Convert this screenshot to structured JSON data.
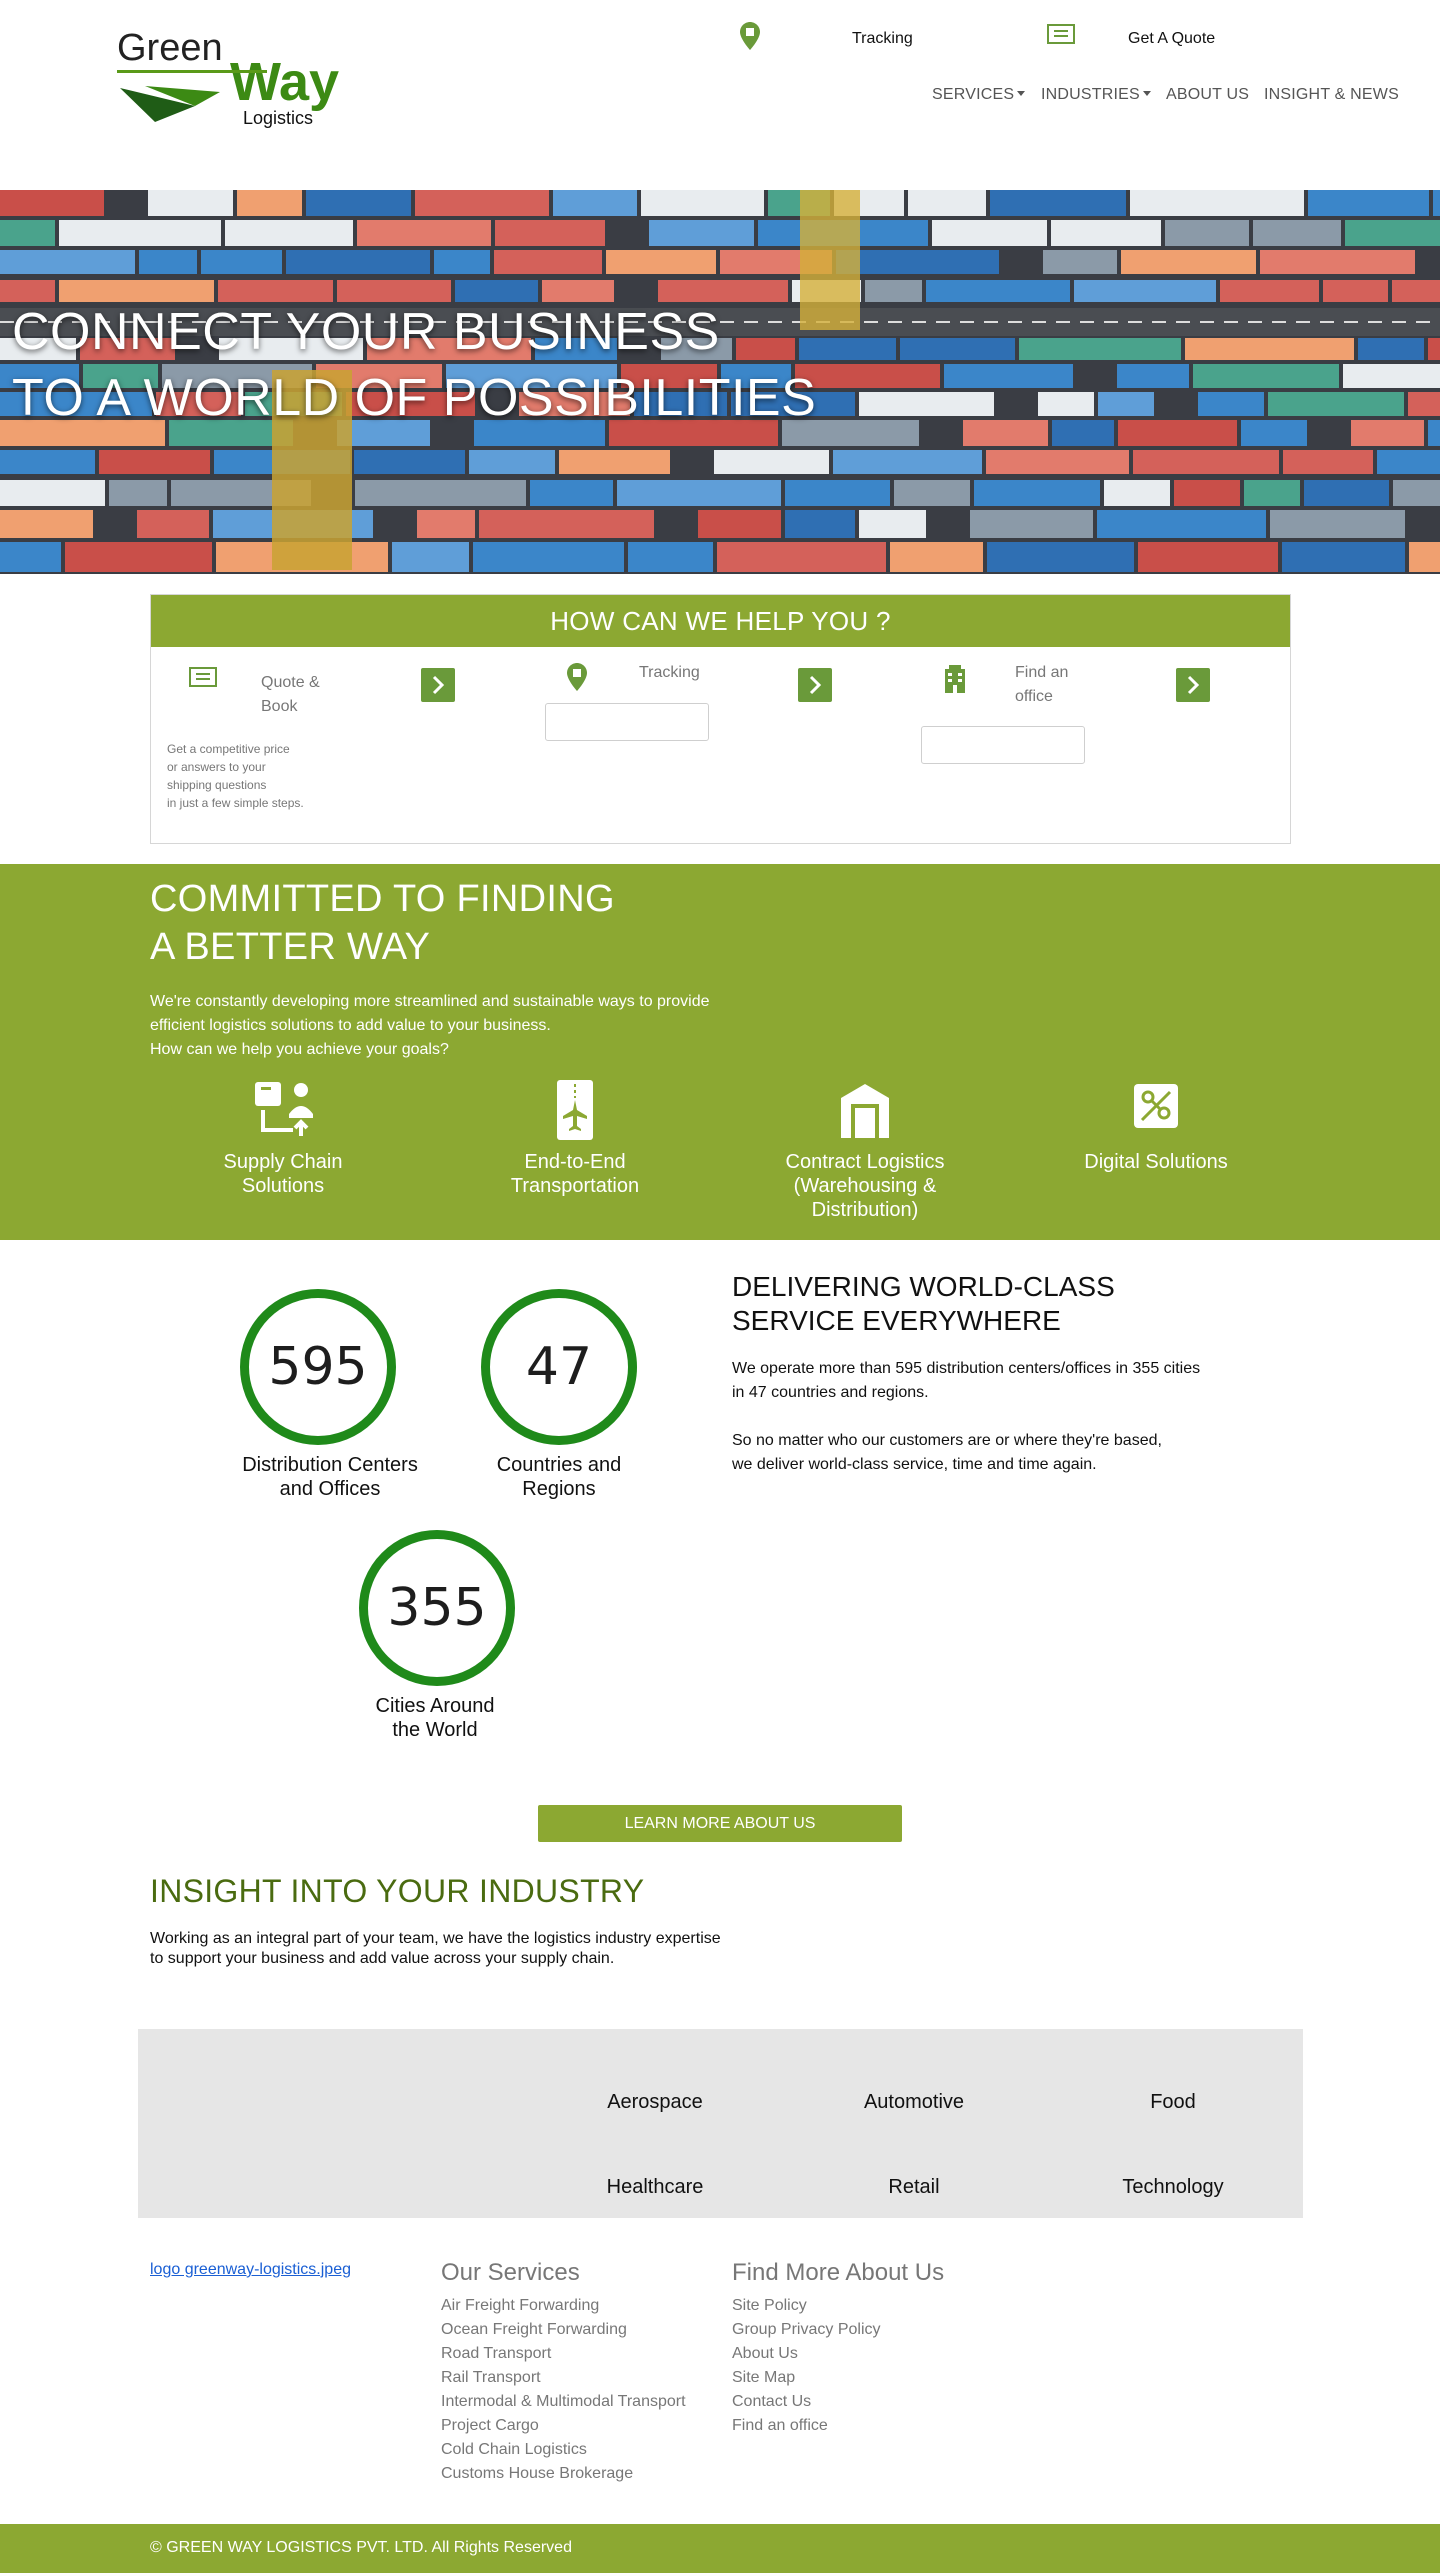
{
  "header": {
    "logo_text": [
      "Green",
      "Way",
      "Logistics"
    ],
    "top_links": {
      "tracking": "Tracking",
      "quote": "Get A Quote"
    },
    "nav": [
      "SERVICES",
      "INDUSTRIES",
      "ABOUT US",
      "INSIGHT & NEWS"
    ]
  },
  "hero": {
    "line1": "CONNECT YOUR BUSINESS",
    "line2": "TO A WORLD OF POSSIBILITIES"
  },
  "help": {
    "title": "HOW CAN WE HELP YOU ?",
    "quote_label": [
      "Quote &",
      "Book"
    ],
    "quote_desc": [
      "Get a competitive price",
      "or answers to your",
      "shipping questions",
      "in just a few simple steps."
    ],
    "tracking_label": "Tracking",
    "office_label": [
      "Find an",
      "office"
    ]
  },
  "committed": {
    "title": [
      "COMMITTED TO FINDING",
      "A BETTER WAY"
    ],
    "desc": [
      "We're constantly developing more streamlined and sustainable ways to provide",
      "efficient logistics solutions to add value to your business.",
      "How can we help you achieve your goals?"
    ],
    "features": [
      {
        "label": [
          "Supply Chain",
          "Solutions"
        ],
        "icon": "supply-chain-icon"
      },
      {
        "label": [
          "End-to-End",
          "Transportation"
        ],
        "icon": "airplane-icon"
      },
      {
        "label": [
          "Contract Logistics",
          "(Warehousing &",
          "Distribution)"
        ],
        "icon": "warehouse-icon"
      },
      {
        "label": [
          "Digital Solutions"
        ],
        "icon": "digital-solutions-icon"
      }
    ]
  },
  "stats": [
    {
      "value": "595",
      "label": [
        "Distribution Centers",
        "and Offices"
      ]
    },
    {
      "value": "47",
      "label": [
        "Countries and",
        "Regions"
      ]
    },
    {
      "value": "355",
      "label": [
        "Cities Around",
        "the World"
      ]
    }
  ],
  "delivering": {
    "title": [
      "DELIVERING WORLD-CLASS",
      "SERVICE EVERYWHERE"
    ],
    "p1": [
      "We operate more than 595 distribution centers/offices in 355 cities",
      "in 47 countries and regions."
    ],
    "p2": [
      "So no matter who our customers are or where they're based,",
      "we deliver world-class service, time and time again."
    ]
  },
  "learn_more": "LEARN MORE ABOUT US",
  "insight": {
    "title": "INSIGHT INTO YOUR INDUSTRY",
    "desc": [
      "Working as an integral part of your team, we have the logistics industry expertise",
      "to support your business and add value across your supply chain."
    ]
  },
  "industries": [
    "Aerospace",
    "Automotive",
    "Food",
    "Healthcare",
    "Retail",
    "Technology"
  ],
  "footer": {
    "logo_alt": "logo greenway-logistics.jpeg",
    "services_title": "Our Services",
    "services": [
      "Air Freight Forwarding",
      "Ocean Freight Forwarding",
      "Road Transport",
      "Rail Transport",
      "Intermodal & Multimodal Transport",
      "Project Cargo",
      "Cold Chain Logistics",
      "Customs House Brokerage"
    ],
    "about_title": "Find More About Us",
    "about": [
      "Site Policy",
      "Group Privacy Policy",
      "About Us",
      "Site Map",
      "Contact Us",
      "Find an office"
    ],
    "copyright": "© GREEN WAY LOGISTICS PVT. LTD. All Rights Reserved"
  },
  "colors": {
    "brand_green": "#8ca832",
    "stat_ring": "#1f8a1a",
    "icon_green": "#6a9a3a",
    "dark_green": "#4a6b10"
  }
}
